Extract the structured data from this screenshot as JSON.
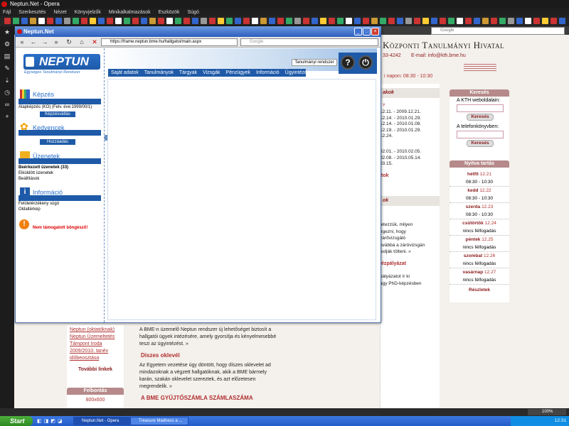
{
  "window": {
    "title": "Neptun.Net - Opera"
  },
  "menu": [
    "Fájl",
    "Szerkesztés",
    "Nézet",
    "Könyvjelzők",
    "Minikalkalmazások",
    "Eszközök",
    "Súgó"
  ],
  "outer_search_placeholder": "Google",
  "kth": {
    "title": "Központi Tanulmányi Hivatal",
    "phone": "33-4242",
    "email": "E-mail:  info@kth.bme.hu",
    "hours": "i napon: 08:30 - 10:30",
    "section1": "akok",
    "dates1": "12.11. - 2009.12.21.\n12.14. - 2010.01.29.\n12.14. - 2010.01.08.\n12.19. - 2010.01.29.\n12.24.",
    "dates2": "02.01. - 2010.02.05.\n02.08. - 2010.05.14.\n03.15.",
    "more1": "tok",
    "section2": "ok",
    "para": "letezzük, milyen\négezni, hogy\nzárővizsgáló\novábbá a záróvizsgán\ntudják tölteni. »",
    "subhead": "ézpályázat",
    "para2": "pályázatot ír ki\nagy PhD-képzésben",
    "search_title": "Keresés",
    "kth_site": "A KTH weboldalain:",
    "phonebook": "A telefonkönyvben:",
    "search_btn": "Keresés",
    "open_title": "Nyitva tartás",
    "days": [
      {
        "day": "hétfő",
        "date": "12.21",
        "slot": "08:30 - 10:30"
      },
      {
        "day": "kedd",
        "date": "12.22",
        "slot": "08:30 - 10:30"
      },
      {
        "day": "szerda",
        "date": "12.23",
        "slot": "08:30 - 10:30"
      },
      {
        "day": "csütörtök",
        "date": "12.24",
        "slot": "nincs félfogadás"
      },
      {
        "day": "péntek",
        "date": "12.25",
        "slot": "nincs félfogadás"
      },
      {
        "day": "szombat",
        "date": "12.26",
        "slot": "nincs félfogadás"
      },
      {
        "day": "vasárnap",
        "date": "12.27",
        "slot": "nincs félfogadás"
      }
    ],
    "details": "Részletek",
    "lowleft": "Neptun (oktatóknak)\nNeptun Üzemeltetés\nTámpont Iroda\n2009/2010. tanév\nidőbeosztása",
    "more_links": "További linkek",
    "resolution_title": "Felbontás",
    "resolution": "800x600",
    "lowmid1": "A BME-n üzemelő Neptun rendszer új lehetőséget biztosít a hallgatói ügyek intézésére, amely gyorsítja és kényelmesebbé teszi az ügyintézést. »",
    "lowhead2": "Diszes oklevél",
    "lowmid2": "Az Egyetem vezetése úgy döntött, hogy díszes oklevelet ad mindazoknak a végzett hallgatóknak, akik a BME bármely karán, szakán oklevelet szereztek, és azt előzetesen megrendelik. »",
    "lowhead3": "A BME GYŰJTŐSZÁMLA SZÁMLASZÁMA"
  },
  "popup": {
    "title": "Neptun.Net",
    "url": "https://frame.neptun.bme.hu/hallgatoi/main.aspx",
    "search_placeholder": "Google",
    "logo": "NEPTUN",
    "logo_sub": "Egységes Tanulmányi Rendszer",
    "kepzes_title": "Képzés",
    "kepzes_text": "Alapképzés (KO) (Felv. éve:1999/00/1)",
    "kepzes_btn": "Képzésváltás",
    "kedvencek_title": "Kedvencek",
    "kedvencek_btn": "Hozzáadás",
    "uzenetek_title": "Üzenetek",
    "uzenet_items": [
      "Beérkezett üzenetek (33)",
      "Elküldött üzenetek",
      "Beállítások"
    ],
    "info_title": "Információ",
    "info_items": [
      "Felületérzékeny súgó",
      "Oldaltérkép"
    ],
    "warning": "Nem támogatott böngésző!",
    "tanulmanyi": "Tanulmányi rendszer",
    "nav": [
      "Saját adatok",
      "Tanulmányok",
      "Tárgyak",
      "Vizsgák",
      "Pénzügyek",
      "Információ",
      "Ügyintézés"
    ]
  },
  "status": {
    "zoom": "100%"
  },
  "taskbar": {
    "start": "Start",
    "tasks": [
      "Neptun.Net - Opera",
      "Treasure Madness a ..."
    ],
    "clock": "12:31"
  }
}
